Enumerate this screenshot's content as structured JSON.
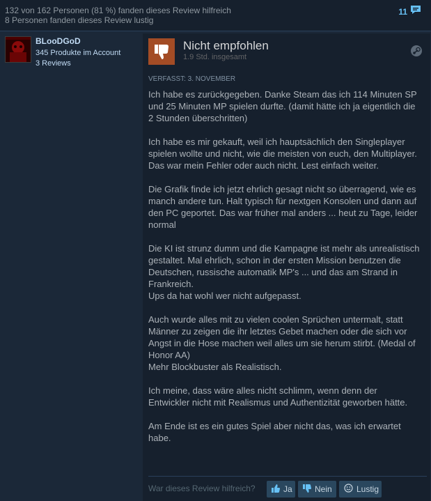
{
  "header": {
    "helpful_line": "132 von 162 Personen (81 %) fanden dieses Review hilfreich",
    "funny_line": "8 Personen fanden dieses Review lustig",
    "comment_count": "11"
  },
  "author": {
    "name": "BLooDGoD",
    "products": "345 Produkte im Account",
    "reviews": "3 Reviews"
  },
  "review": {
    "verdict": "Nicht empfohlen",
    "hours": "1.9 Std. insgesamt",
    "posted": "VERFASST: 3. NOVEMBER",
    "paragraphs": [
      "Ich habe es zurückgegeben. Danke Steam das ich 114 Minuten SP und 25 Minuten MP spielen durfte. (damit hätte ich ja eigentlich die 2 Stunden überschritten)",
      "Ich habe es mir gekauft, weil ich hauptsächlich den Singleplayer spielen wollte und nicht, wie die meisten von euch, den Multiplayer. Das war mein Fehler oder auch nicht. Lest einfach weiter.",
      "Die Grafik finde ich jetzt ehrlich gesagt nicht so überragend, wie es manch andere tun. Halt typisch für nextgen Konsolen und dann auf den PC geportet. Das war früher mal anders ... heut zu Tage, leider normal",
      "Die KI ist strunz dumm und die Kampagne ist mehr als unrealistisch gestaltet. Mal ehrlich, schon in der ersten Mission benutzen die Deutschen, russische automatik MP's ... und das am Strand in Frankreich.",
      "Ups da hat wohl wer nicht aufgepasst.",
      "Auch wurde alles mit zu vielen coolen Sprüchen untermalt, statt Männer zu zeigen die ihr letztes Gebet machen oder die sich vor Angst in die Hose machen weil alles um sie herum stirbt. (Medal of Honor AA)",
      "Mehr Blockbuster als Realistisch.",
      "Ich meine, dass wäre alles nicht schlimm, wenn denn der Entwickler nicht mit Realismus und Authentizität geworben hätte.",
      "Am Ende ist es ein gutes Spiel aber nicht das, was ich erwartet habe."
    ]
  },
  "footer": {
    "question": "War dieses Review hilfreich?",
    "yes": "Ja",
    "no": "Nein",
    "funny": "Lustig"
  },
  "colors": {
    "background": "#1b2838",
    "panel": "#16202d",
    "thumb_down": "#a34c25",
    "link": "#66c0f4",
    "button": "#2a475e"
  },
  "icons": [
    "comment-icon",
    "thumbs-down-icon",
    "steam-icon",
    "thumbs-up-icon",
    "smiley-icon"
  ]
}
